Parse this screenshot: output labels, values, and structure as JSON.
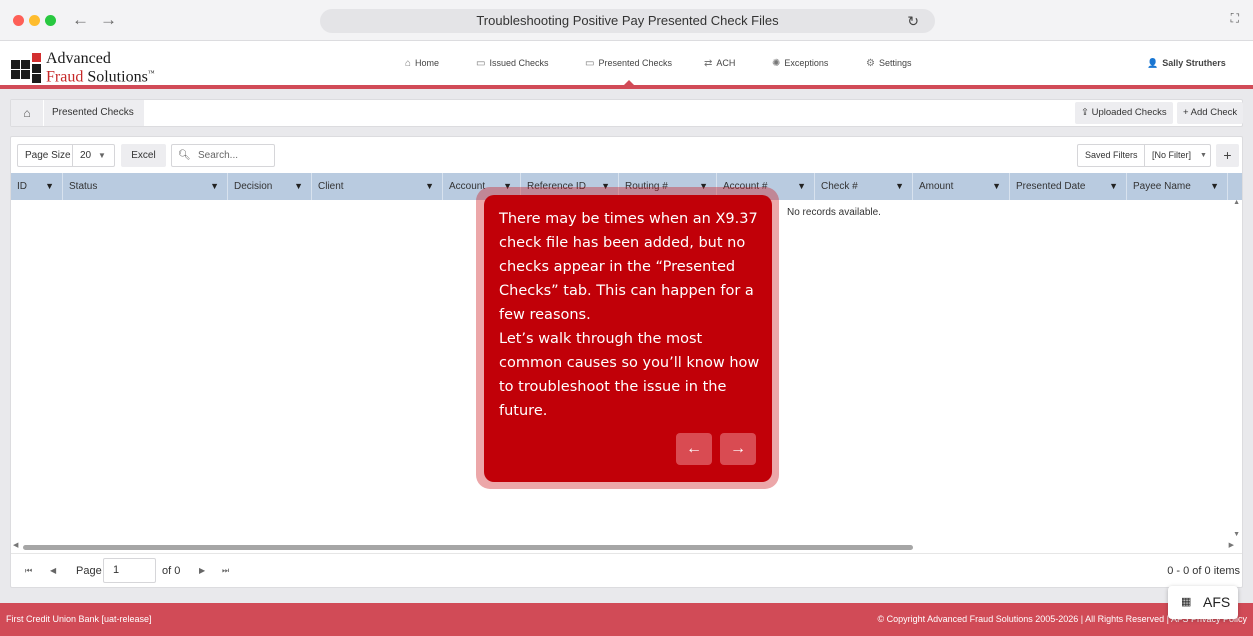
{
  "browser": {
    "title": "Troubleshooting Positive Pay Presented Check Files",
    "back_glyph": "←",
    "forward_glyph": "→",
    "reload_glyph": "↻",
    "expand_glyph": "⛶"
  },
  "logo": {
    "line1": "Advanced",
    "line2_a": "Fraud",
    "line2_b": " Solutions",
    "tm": "™"
  },
  "nav": {
    "home": "Home",
    "issued": "Issued Checks",
    "presented": "Presented Checks",
    "ach": "ACH",
    "exceptions": "Exceptions",
    "settings": "Settings",
    "active": "Presented Checks"
  },
  "user": {
    "name": "Sally Struthers"
  },
  "breadcrumb": {
    "item": "Presented Checks"
  },
  "actions": {
    "uploaded": "Uploaded Checks",
    "add": "+ Add Check"
  },
  "toolbar": {
    "page_size_label": "Page Size",
    "page_size_value": "20",
    "excel": "Excel",
    "search_placeholder": "Search...",
    "saved_filters": "Saved Filters",
    "filter_value": "[No Filter]",
    "plus": "+"
  },
  "grid": {
    "columns": [
      "ID",
      "Status",
      "Decision",
      "Client",
      "Account",
      "Reference ID",
      "Routing #",
      "Account #",
      "Check #",
      "Amount",
      "Presented Date",
      "Payee Name"
    ],
    "empty_message": "No records available."
  },
  "pager": {
    "page_label": "Page",
    "page_value": "1",
    "of_label": "of 0",
    "items": "0 - 0 of 0 items"
  },
  "footer": {
    "left": "First Credit Union Bank  [uat-release]",
    "right": "© Copyright Advanced Fraud Solutions 2005-2026 |  All Rights Reserved  |  AFS Privacy Policy"
  },
  "afs_badge": "AFS",
  "tooltip": {
    "text": "There may be times when an X9.37 check file has been added, but no checks appear in the “Presented Checks” tab. This can happen for a few reasons.\nLet’s walk through the most common causes so you’ll know how to troubleshoot the issue in the future.",
    "prev": "←",
    "next": "→"
  },
  "colors": {
    "accent": "#d14b57",
    "tooltip": "#c10008",
    "grid_header": "#b9cbe0"
  }
}
